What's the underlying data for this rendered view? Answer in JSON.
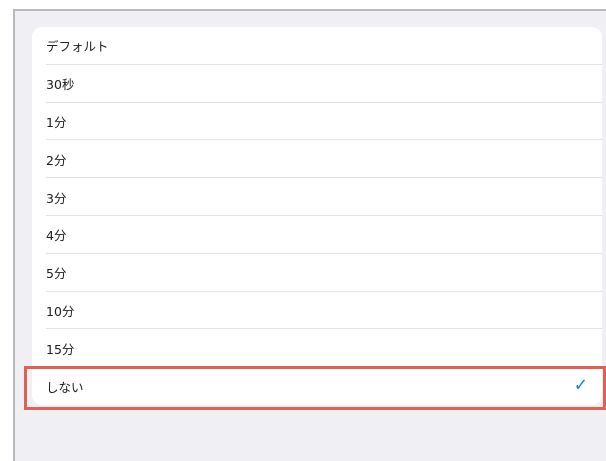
{
  "options": [
    {
      "label": "デフォルト",
      "selected": false
    },
    {
      "label": "30秒",
      "selected": false
    },
    {
      "label": "1分",
      "selected": false
    },
    {
      "label": "2分",
      "selected": false
    },
    {
      "label": "3分",
      "selected": false
    },
    {
      "label": "4分",
      "selected": false
    },
    {
      "label": "5分",
      "selected": false
    },
    {
      "label": "10分",
      "selected": false
    },
    {
      "label": "15分",
      "selected": false
    },
    {
      "label": "しない",
      "selected": true
    }
  ],
  "check_icon": "checkmark-icon",
  "colors": {
    "background": "#efeff4",
    "card": "#ffffff",
    "separator": "#e2e2e6",
    "accent": "#0a7cf6",
    "highlight": "#e06055"
  }
}
